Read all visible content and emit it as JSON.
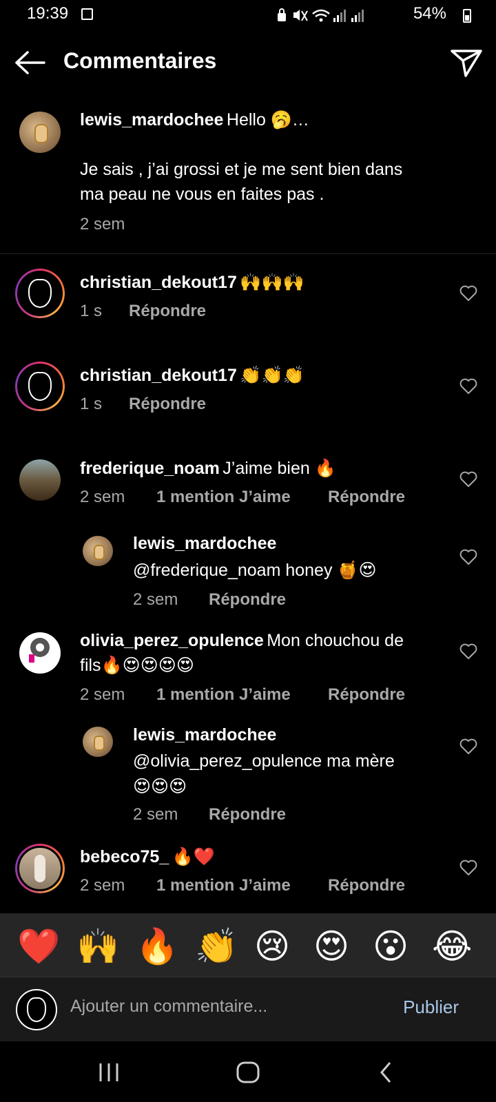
{
  "status_bar": {
    "time": "19:39",
    "battery": "54%",
    "icons": [
      "image-icon",
      "lock-icon",
      "mute-icon",
      "wifi-icon",
      "signal-icon",
      "signal-icon-2",
      "battery-icon"
    ]
  },
  "header": {
    "title": "Commentaires"
  },
  "caption": {
    "username": "lewis_mardochee",
    "text_line1": "Hello 🥱…",
    "text_line2": "Je sais , j’ai grossi et je me sent bien dans",
    "text_line3": "ma peau ne vous en faites pas .",
    "time": "2 sem"
  },
  "comments": [
    {
      "username": "christian_dekout17",
      "text": "🙌🙌🙌",
      "time": "1 s",
      "reply": "Répondre"
    },
    {
      "username": "christian_dekout17",
      "text": "👏👏👏",
      "time": "1 s",
      "reply": "Répondre"
    },
    {
      "username": "frederique_noam",
      "text": "J’aime bien 🔥",
      "time": "2 sem",
      "likes": "1 mention J’aime",
      "reply": "Répondre"
    },
    {
      "username": "lewis_mardochee",
      "text": "@frederique_noam honey 🍯😍",
      "time": "2 sem",
      "reply": "Répondre"
    },
    {
      "username": "olivia_perez_opulence",
      "text_line1": "Mon chouchou de",
      "text_line2": "fils🔥😍😍😍😍",
      "time": "2 sem",
      "likes": "1 mention J’aime",
      "reply": "Répondre"
    },
    {
      "username": "lewis_mardochee",
      "text_line1": "@olivia_perez_opulence ma mère",
      "text_line2": "😍😍😍",
      "time": "2 sem",
      "reply": "Répondre"
    },
    {
      "username": "bebeco75_",
      "text": "🔥❤️",
      "time": "2 sem",
      "likes": "1 mention J’aime",
      "reply": "Répondre"
    }
  ],
  "emoji_bar": [
    "❤️",
    "🙌",
    "🔥",
    "👏",
    "😢",
    "😍",
    "😮",
    "😂"
  ],
  "input": {
    "placeholder": "Ajouter un commentaire...",
    "publish": "Publier"
  },
  "colors": {
    "background": "#000000",
    "secondary_text": "#a8a8a8",
    "publish": "#a9c7e8",
    "emoji_bar_bg": "#262626"
  }
}
